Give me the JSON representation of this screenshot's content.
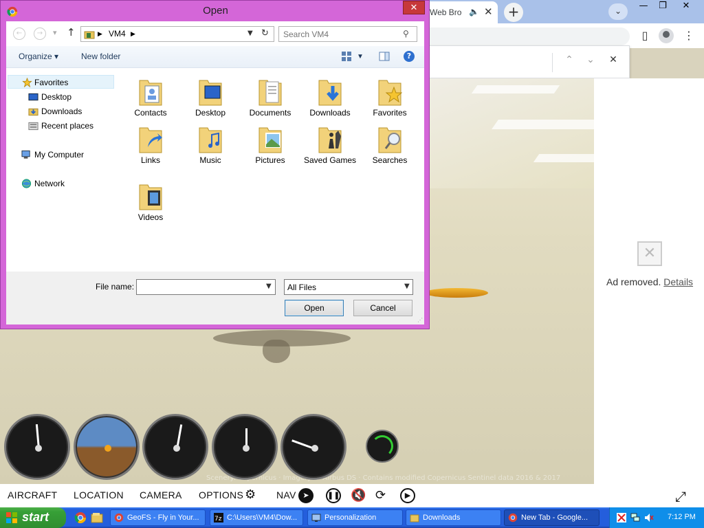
{
  "browser": {
    "tab_title": "Web Bro",
    "tab_audio_icon": "speaker-icon",
    "new_tab_symbol": "+",
    "minimize_symbol": "—",
    "restore_symbol": "❐",
    "close_symbol": "✕"
  },
  "findbar": {
    "up_symbol": "⌃",
    "down_symbol": "⌄",
    "close_symbol": "✕"
  },
  "ad": {
    "text": "Ad removed.",
    "link": "Details"
  },
  "game": {
    "credits": "Scenery: Copernicus · Imagery © Airbus DS · Contains modified Copernicus Sentinel data 2016 & 2017",
    "menu": {
      "aircraft": "AIRCRAFT",
      "location": "LOCATION",
      "camera": "CAMERA",
      "options": "OPTIONS",
      "nav": "NAV"
    }
  },
  "dialog": {
    "title": "Open",
    "close_symbol": "✕",
    "path": [
      "VM4"
    ],
    "search_placeholder": "Search VM4",
    "organize": "Organize ▾",
    "new_folder": "New folder",
    "nav_items": [
      {
        "label": "Favorites",
        "icon": "star-icon"
      },
      {
        "label": "Desktop",
        "icon": "desktop-icon"
      },
      {
        "label": "Downloads",
        "icon": "downloads-icon"
      },
      {
        "label": "Recent places",
        "icon": "recent-places-icon"
      },
      {
        "label": "My Computer",
        "icon": "computer-icon"
      },
      {
        "label": "Network",
        "icon": "network-icon"
      }
    ],
    "folders": [
      {
        "name": "Contacts",
        "icon": "contacts-folder-icon"
      },
      {
        "name": "Desktop",
        "icon": "desktop-folder-icon"
      },
      {
        "name": "Documents",
        "icon": "documents-folder-icon"
      },
      {
        "name": "Downloads",
        "icon": "downloads-folder-icon"
      },
      {
        "name": "Favorites",
        "icon": "favorites-folder-icon"
      },
      {
        "name": "Links",
        "icon": "links-folder-icon"
      },
      {
        "name": "Music",
        "icon": "music-folder-icon"
      },
      {
        "name": "Pictures",
        "icon": "pictures-folder-icon"
      },
      {
        "name": "Saved Games",
        "icon": "saved-games-folder-icon"
      },
      {
        "name": "Searches",
        "icon": "searches-folder-icon"
      },
      {
        "name": "Videos",
        "icon": "videos-folder-icon"
      }
    ],
    "file_name_label": "File name:",
    "file_name_value": "",
    "file_type": "All Files",
    "open_button": "Open",
    "cancel_button": "Cancel"
  },
  "taskbar": {
    "start": "start",
    "tasks": [
      {
        "label": "GeoFS - Fly in Your...",
        "icon": "chrome-icon"
      },
      {
        "label": "C:\\Users\\VM4\\Dow...",
        "icon": "7zip-icon"
      },
      {
        "label": "Personalization",
        "icon": "personalization-icon"
      },
      {
        "label": "Downloads",
        "icon": "folder-icon"
      },
      {
        "label": "New Tab - Google...",
        "icon": "chrome-icon"
      }
    ],
    "clock": "7:12 PM"
  },
  "colors": {
    "dialog_frame": "#d466d8",
    "taskbar": "#245edc",
    "start": "#37a037"
  }
}
